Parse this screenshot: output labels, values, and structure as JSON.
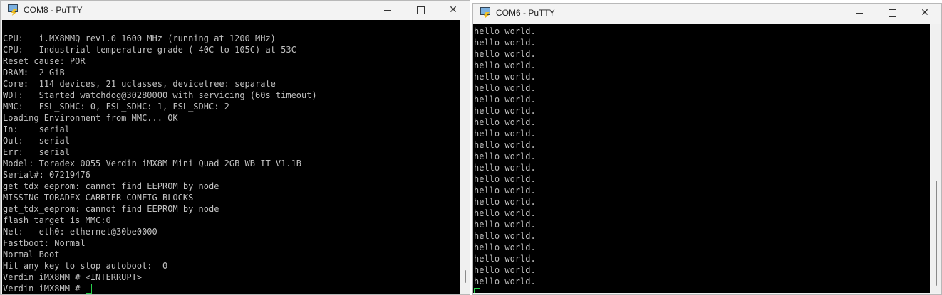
{
  "left_window": {
    "title": "COM8 - PuTTY",
    "controls": {
      "close": "✕"
    },
    "lines": [
      "CPU:   i.MX8MMQ rev1.0 1600 MHz (running at 1200 MHz)",
      "CPU:   Industrial temperature grade (-40C to 105C) at 53C",
      "Reset cause: POR",
      "DRAM:  2 GiB",
      "Core:  114 devices, 21 uclasses, devicetree: separate",
      "WDT:   Started watchdog@30280000 with servicing (60s timeout)",
      "MMC:   FSL_SDHC: 0, FSL_SDHC: 1, FSL_SDHC: 2",
      "Loading Environment from MMC... OK",
      "In:    serial",
      "Out:   serial",
      "Err:   serial",
      "Model: Toradex 0055 Verdin iMX8M Mini Quad 2GB WB IT V1.1B",
      "Serial#: 07219476",
      "get_tdx_eeprom: cannot find EEPROM by node",
      "MISSING TORADEX CARRIER CONFIG BLOCKS",
      "get_tdx_eeprom: cannot find EEPROM by node",
      "flash target is MMC:0",
      "Net:   eth0: ethernet@30be0000",
      "Fastboot: Normal",
      "Normal Boot",
      "Hit any key to stop autoboot:  0",
      "Verdin iMX8MM # <INTERRUPT>"
    ],
    "prompt": "Verdin iMX8MM # "
  },
  "right_window": {
    "title": "COM6 - PuTTY",
    "controls": {
      "close": "✕"
    },
    "lines": [
      "hello world.",
      "hello world.",
      "hello world.",
      "hello world.",
      "hello world.",
      "hello world.",
      "hello world.",
      "hello world.",
      "hello world.",
      "hello world.",
      "hello world.",
      "hello world.",
      "hello world.",
      "hello world.",
      "hello world.",
      "hello world.",
      "hello world.",
      "hello world.",
      "hello world.",
      "hello world.",
      "hello world.",
      "hello world.",
      "hello world."
    ]
  },
  "colors": {
    "terminal_bg": "#000000",
    "terminal_fg": "#c0c0c0",
    "cursor": "#29d14c"
  }
}
